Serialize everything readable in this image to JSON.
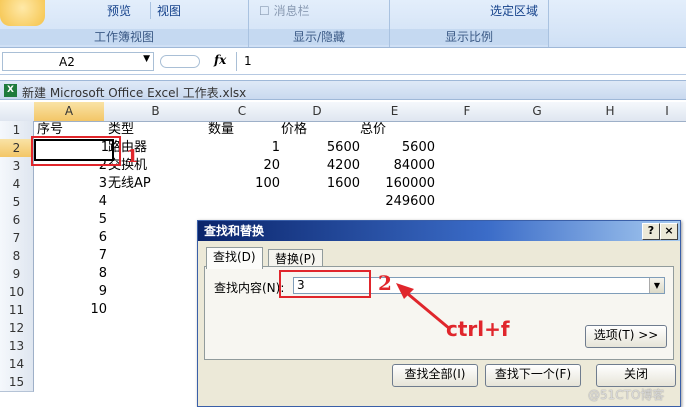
{
  "ribbon": {
    "buttons": [
      "预览",
      "视图",
      "消息栏",
      "选定区域"
    ],
    "groups": [
      "工作簿视图",
      "显示/隐藏",
      "显示比例"
    ]
  },
  "formula_bar": {
    "name_box": "A2",
    "fx_label": "fx",
    "value": "1"
  },
  "workbook_title": "新建 Microsoft Office Excel 工作表.xlsx",
  "grid": {
    "columns": [
      "A",
      "B",
      "C",
      "D",
      "E",
      "F",
      "G",
      "H",
      "I"
    ],
    "rows": [
      "1",
      "2",
      "3",
      "4",
      "5",
      "6",
      "7",
      "8",
      "9",
      "10",
      "11",
      "12",
      "13",
      "14",
      "15"
    ],
    "cells": {
      "r1": [
        "序号",
        "类型",
        "数量",
        "价格",
        "总价"
      ],
      "r2": [
        "1",
        "路由器",
        "1",
        "5600",
        "5600"
      ],
      "r3": [
        "2",
        "交换机",
        "20",
        "4200",
        "84000"
      ],
      "r4": [
        "3",
        "无线AP",
        "100",
        "1600",
        "160000"
      ],
      "r5": [
        "4",
        "",
        "",
        "",
        "249600"
      ],
      "a_rest": [
        "5",
        "6",
        "7",
        "8",
        "9",
        "10"
      ]
    }
  },
  "dialog": {
    "title": "查找和替换",
    "help": "?",
    "close": "×",
    "tabs": [
      "查找(D)",
      "替换(P)"
    ],
    "find_label": "查找内容(N):",
    "find_value": "3",
    "options_button": "选项(T) >>",
    "find_all": "查找全部(I)",
    "find_next": "查找下一个(F)",
    "close_button": "关闭"
  },
  "annotations": {
    "n1": "1",
    "n2": "2",
    "shortcut": "ctrl+f",
    "accent": "#e0262c"
  },
  "watermark": "@51CTO博客"
}
